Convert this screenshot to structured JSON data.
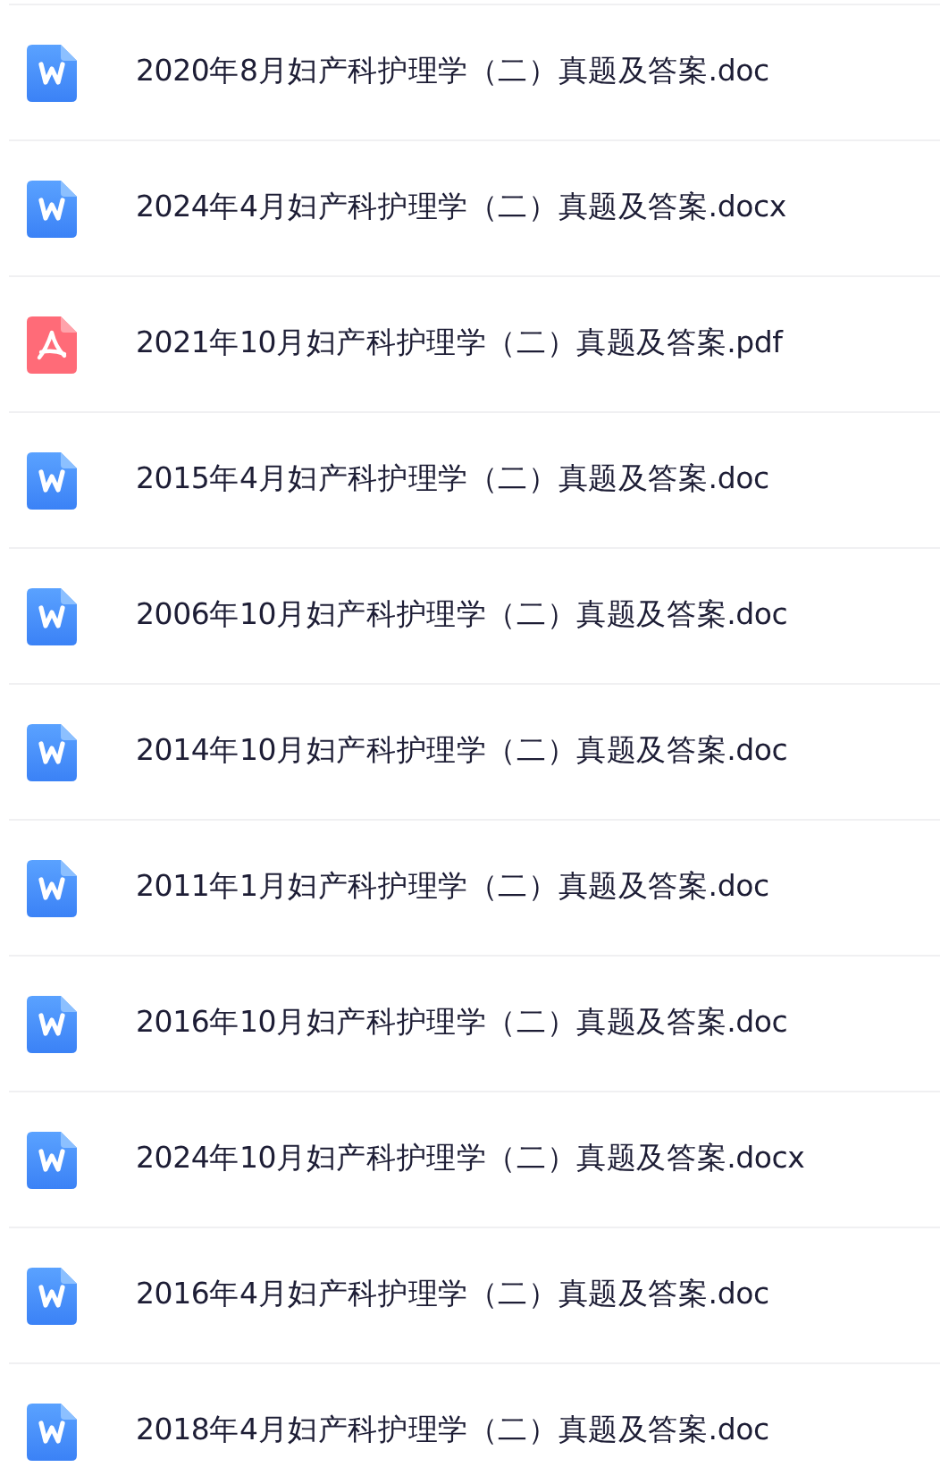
{
  "files": [
    {
      "kind": "word",
      "name": "2020年8月妇产科护理学（二）真题及答案.doc"
    },
    {
      "kind": "word",
      "name": "2024年4月妇产科护理学（二）真题及答案.docx"
    },
    {
      "kind": "pdf",
      "name": "2021年10月妇产科护理学（二）真题及答案.pdf"
    },
    {
      "kind": "word",
      "name": "2015年4月妇产科护理学（二）真题及答案.doc"
    },
    {
      "kind": "word",
      "name": "2006年10月妇产科护理学（二）真题及答案.doc"
    },
    {
      "kind": "word",
      "name": "2014年10月妇产科护理学（二）真题及答案.doc"
    },
    {
      "kind": "word",
      "name": "2011年1月妇产科护理学（二）真题及答案.doc"
    },
    {
      "kind": "word",
      "name": "2016年10月妇产科护理学（二）真题及答案.doc"
    },
    {
      "kind": "word",
      "name": "2024年10月妇产科护理学（二）真题及答案.docx"
    },
    {
      "kind": "word",
      "name": "2016年4月妇产科护理学（二）真题及答案.doc"
    },
    {
      "kind": "word",
      "name": "2018年4月妇产科护理学（二）真题及答案.doc"
    }
  ]
}
